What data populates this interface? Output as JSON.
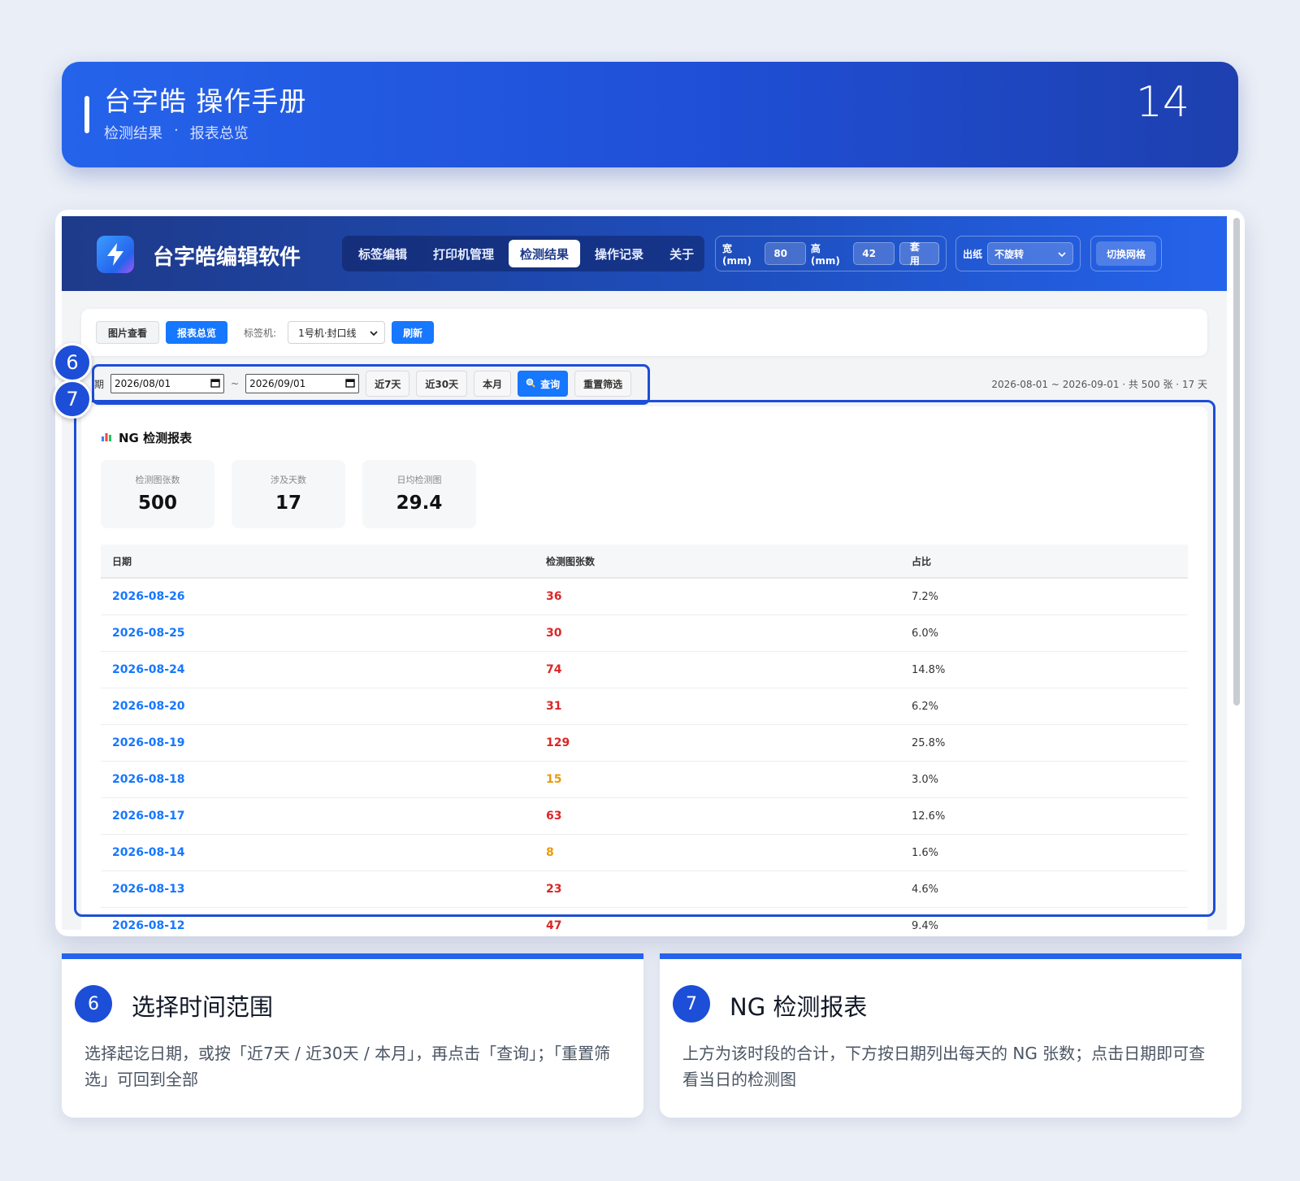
{
  "banner": {
    "title": "台字皓 操作手册",
    "subtitle_left": "检测结果",
    "subtitle_sep": "·",
    "subtitle_right": "报表总览",
    "page_number": "14"
  },
  "app": {
    "name": "台字皓编辑软件",
    "nav_tabs": [
      {
        "label": "标签编辑"
      },
      {
        "label": "打印机管理"
      },
      {
        "label": "检测结果",
        "active": true
      },
      {
        "label": "操作记录"
      },
      {
        "label": "关于"
      }
    ],
    "width_label": "宽(mm)",
    "width_value": "80",
    "height_label": "高(mm)",
    "height_value": "42",
    "apply_label": "套用",
    "paper_label": "出纸",
    "rotation_value": "不旋转",
    "grid_toggle_label": "切换网格"
  },
  "subbar": {
    "image_view_label": "图片查看",
    "report_label": "报表总览",
    "labeler_label": "标签机:",
    "labeler_value": "1号机·封口线",
    "refresh_label": "刷新"
  },
  "filter": {
    "date_label_partial": "期",
    "start_date": "2026/08/01",
    "tilde": "~",
    "end_date": "2026/09/01",
    "last7_label": "近7天",
    "last30_label": "近30天",
    "this_month_label": "本月",
    "query_label": "查询",
    "reset_label": "重置筛选",
    "range_info": "2026-08-01 ~ 2026-09-01 · 共 500 张 · 17 天"
  },
  "report": {
    "title": "NG 检测报表",
    "stats": [
      {
        "key": "检测图张数",
        "value": "500"
      },
      {
        "key": "涉及天数",
        "value": "17"
      },
      {
        "key": "日均检测图",
        "value": "29.4"
      }
    ],
    "columns": [
      "日期",
      "检测图张数",
      "占比"
    ],
    "rows": [
      {
        "date": "2026-08-26",
        "count": "36",
        "ratio": "7.2%",
        "level": "high"
      },
      {
        "date": "2026-08-25",
        "count": "30",
        "ratio": "6.0%",
        "level": "high"
      },
      {
        "date": "2026-08-24",
        "count": "74",
        "ratio": "14.8%",
        "level": "high"
      },
      {
        "date": "2026-08-20",
        "count": "31",
        "ratio": "6.2%",
        "level": "high"
      },
      {
        "date": "2026-08-19",
        "count": "129",
        "ratio": "25.8%",
        "level": "high"
      },
      {
        "date": "2026-08-18",
        "count": "15",
        "ratio": "3.0%",
        "level": "low"
      },
      {
        "date": "2026-08-17",
        "count": "63",
        "ratio": "12.6%",
        "level": "high"
      },
      {
        "date": "2026-08-14",
        "count": "8",
        "ratio": "1.6%",
        "level": "low"
      },
      {
        "date": "2026-08-13",
        "count": "23",
        "ratio": "4.6%",
        "level": "high"
      },
      {
        "date": "2026-08-12",
        "count": "47",
        "ratio": "9.4%",
        "level": "high"
      }
    ]
  },
  "markers": {
    "m6": "6",
    "m7": "7"
  },
  "cards": [
    {
      "num": "6",
      "title": "选择时间范围",
      "text": "选择起讫日期，或按「近7天 / 近30天 / 本月」，再点击「查询」；「重置筛选」可回到全部"
    },
    {
      "num": "7",
      "title": "NG 检测报表",
      "text": "上方为该时段的合计，下方按日期列出每天的 NG 张数；点击日期即可查看当日的检测图"
    }
  ],
  "colors": {
    "accent": "#2563eb",
    "count_high": "#dc2626",
    "count_low": "#ea9a0c",
    "date_link": "#1677ff"
  }
}
